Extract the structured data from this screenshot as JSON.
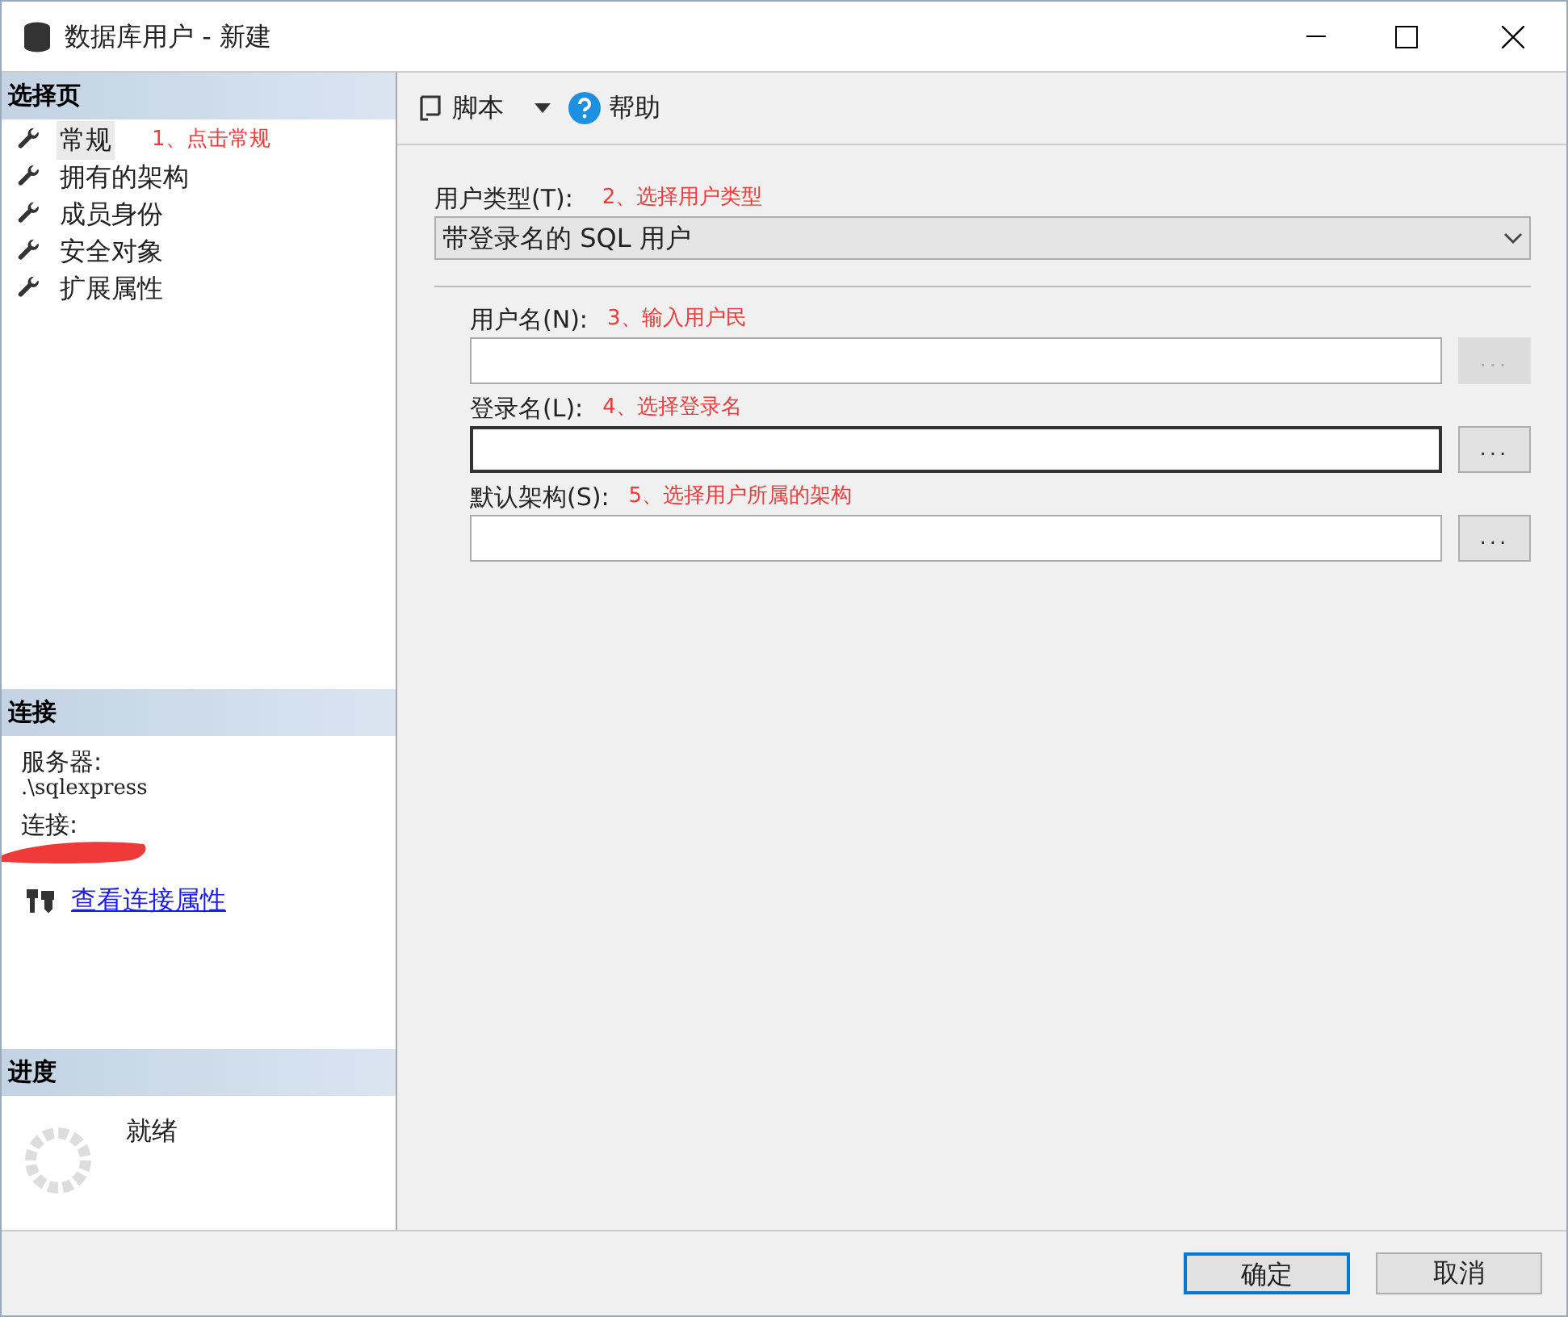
{
  "window": {
    "title": "数据库用户 - 新建"
  },
  "select_page": {
    "header": "选择页",
    "items": [
      {
        "label": "常规",
        "selected": true
      },
      {
        "label": "拥有的架构",
        "selected": false
      },
      {
        "label": "成员身份",
        "selected": false
      },
      {
        "label": "安全对象",
        "selected": false
      },
      {
        "label": "扩展属性",
        "selected": false
      }
    ],
    "annotation": "1、点击常规"
  },
  "connection": {
    "header": "连接",
    "server_label": "服务器:",
    "server": ".\\sqlexpress",
    "connection_label": "连接:",
    "link": "查看连接属性"
  },
  "progress": {
    "header": "进度",
    "status": "就绪"
  },
  "toolbar": {
    "script": "脚本",
    "help": "帮助"
  },
  "user_type": {
    "label": "用户类型(T):",
    "annotation": "2、选择用户类型",
    "value": "带登录名的 SQL 用户"
  },
  "fields": [
    {
      "label": "用户名(N):",
      "annotation": "3、输入用户民",
      "focused": false,
      "browse": "...",
      "browse_disabled": true
    },
    {
      "label": "登录名(L):",
      "annotation": "4、选择登录名",
      "focused": true,
      "browse": "...",
      "browse_disabled": false
    },
    {
      "label": "默认架构(S):",
      "annotation": "5、选择用户所属的架构",
      "focused": false,
      "browse": "...",
      "browse_disabled": false
    }
  ],
  "buttons": [
    {
      "label": "确定",
      "default": true
    },
    {
      "label": "取消",
      "default": false
    }
  ]
}
